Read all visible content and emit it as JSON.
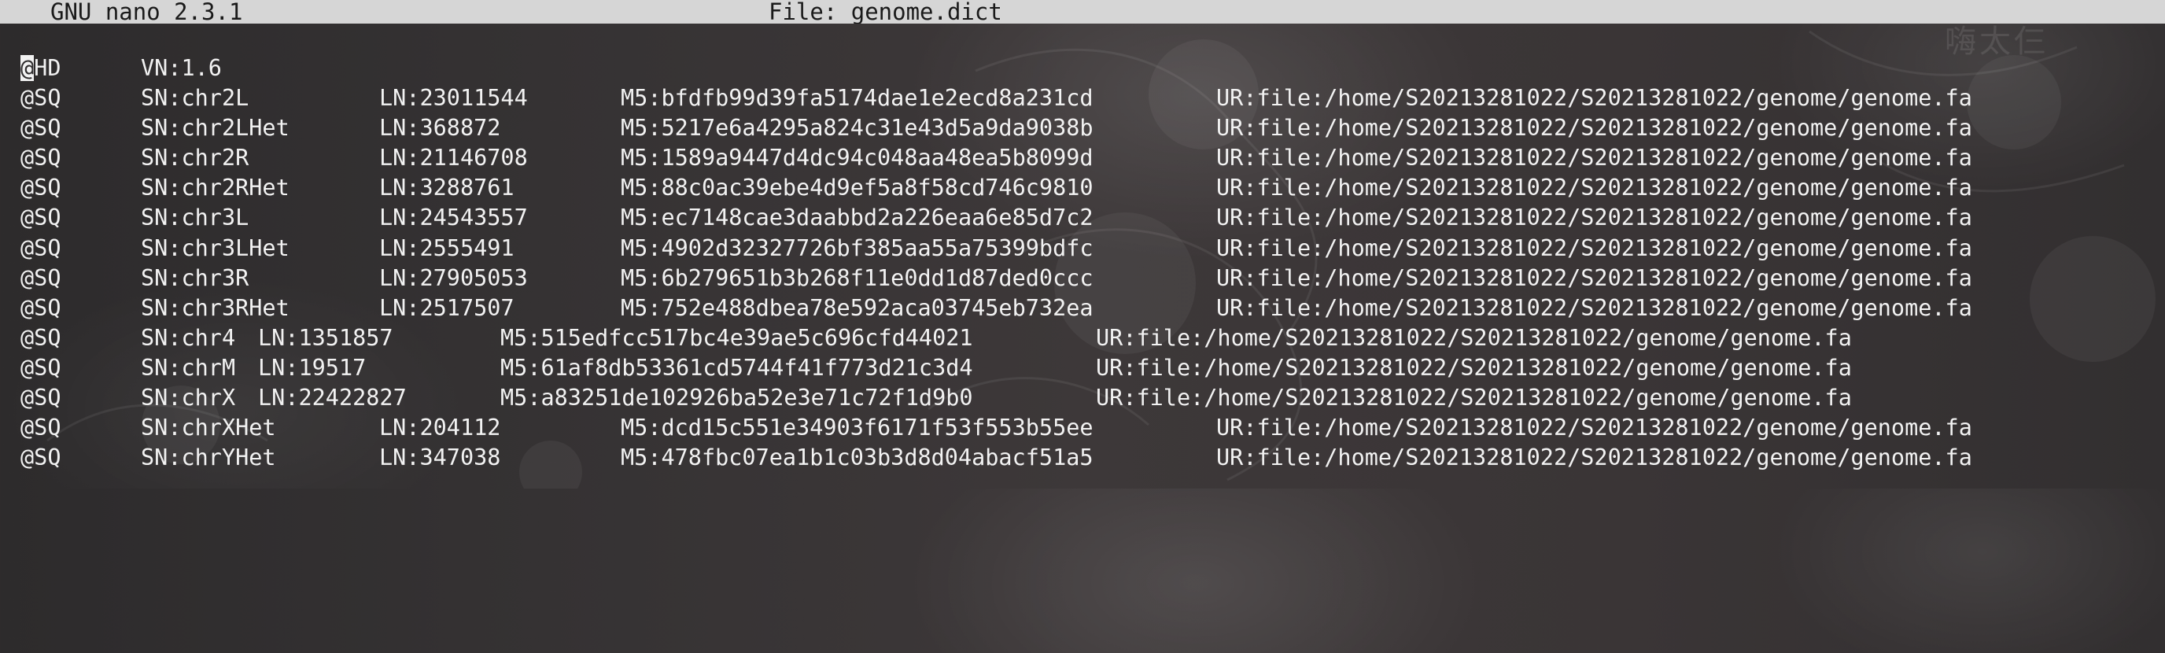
{
  "titlebar": {
    "app": "GNU nano 2.3.1",
    "file": "File: genome.dict"
  },
  "header_line": {
    "tag": "@HD",
    "version": "VN:1.6"
  },
  "sequences": [
    {
      "tag": "@SQ",
      "sn": "SN:chr2L",
      "ln": "LN:23011544",
      "m5": "M5:bfdfb99d39fa5174dae1e2ecd8a231cd",
      "ur": "UR:file:/home/S20213281022/S20213281022/genome/genome.fa"
    },
    {
      "tag": "@SQ",
      "sn": "SN:chr2LHet",
      "ln": "LN:368872",
      "m5": "M5:5217e6a4295a824c31e43d5a9da9038b",
      "ur": "UR:file:/home/S20213281022/S20213281022/genome/genome.fa"
    },
    {
      "tag": "@SQ",
      "sn": "SN:chr2R",
      "ln": "LN:21146708",
      "m5": "M5:1589a9447d4dc94c048aa48ea5b8099d",
      "ur": "UR:file:/home/S20213281022/S20213281022/genome/genome.fa"
    },
    {
      "tag": "@SQ",
      "sn": "SN:chr2RHet",
      "ln": "LN:3288761",
      "m5": "M5:88c0ac39ebe4d9ef5a8f58cd746c9810",
      "ur": "UR:file:/home/S20213281022/S20213281022/genome/genome.fa"
    },
    {
      "tag": "@SQ",
      "sn": "SN:chr3L",
      "ln": "LN:24543557",
      "m5": "M5:ec7148cae3daabbd2a226eaa6e85d7c2",
      "ur": "UR:file:/home/S20213281022/S20213281022/genome/genome.fa"
    },
    {
      "tag": "@SQ",
      "sn": "SN:chr3LHet",
      "ln": "LN:2555491",
      "m5": "M5:4902d32327726bf385aa55a75399bdfc",
      "ur": "UR:file:/home/S20213281022/S20213281022/genome/genome.fa"
    },
    {
      "tag": "@SQ",
      "sn": "SN:chr3R",
      "ln": "LN:27905053",
      "m5": "M5:6b279651b3b268f11e0dd1d87ded0ccc",
      "ur": "UR:file:/home/S20213281022/S20213281022/genome/genome.fa"
    },
    {
      "tag": "@SQ",
      "sn": "SN:chr3RHet",
      "ln": "LN:2517507",
      "m5": "M5:752e488dbea78e592aca03745eb732ea",
      "ur": "UR:file:/home/S20213281022/S20213281022/genome/genome.fa"
    },
    {
      "tag": "@SQ",
      "sn": "SN:chr4",
      "ln": "LN:1351857",
      "m5": "M5:515edfcc517bc4e39ae5c696cfd44021",
      "ur": "UR:file:/home/S20213281022/S20213281022/genome/genome.fa"
    },
    {
      "tag": "@SQ",
      "sn": "SN:chrM",
      "ln": "LN:19517",
      "m5": "M5:61af8db53361cd5744f41f773d21c3d4",
      "ur": "UR:file:/home/S20213281022/S20213281022/genome/genome.fa"
    },
    {
      "tag": "@SQ",
      "sn": "SN:chrX",
      "ln": "LN:22422827",
      "m5": "M5:a83251de102926ba52e3e71c72f1d9b0",
      "ur": "UR:file:/home/S20213281022/S20213281022/genome/genome.fa"
    },
    {
      "tag": "@SQ",
      "sn": "SN:chrXHet",
      "ln": "LN:204112",
      "m5": "M5:dcd15c551e34903f6171f53f553b55ee",
      "ur": "UR:file:/home/S20213281022/S20213281022/genome/genome.fa"
    },
    {
      "tag": "@SQ",
      "sn": "SN:chrYHet",
      "ln": "LN:347038",
      "m5": "M5:478fbc07ea1b1c03b3d8d04abacf51a5",
      "ur": "UR:file:/home/S20213281022/S20213281022/genome/genome.fa"
    }
  ],
  "colors": {
    "title_bar_bg": "#d6d6d6",
    "title_bar_fg": "#1a1a1a",
    "text": "#f2f2f2",
    "background": "#383435"
  }
}
